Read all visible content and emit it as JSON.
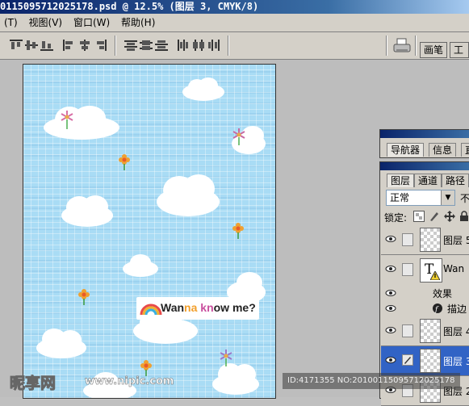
{
  "window": {
    "title": "0115095712025178.psd @ 12.5% (图层 3, CMYK/8)"
  },
  "menu": [
    {
      "label": "(T)"
    },
    {
      "label": "视图(V)"
    },
    {
      "label": "窗口(W)"
    },
    {
      "label": "帮助(H)"
    }
  ],
  "options_bar": {
    "palette_well_tabs": [
      {
        "label": "画笔"
      },
      {
        "label": "工具"
      }
    ]
  },
  "document": {
    "text_layer_content": {
      "part1": "Wan",
      "part2": "na ",
      "part3": "kn",
      "part4": "ow me?"
    }
  },
  "navigator_panel": {
    "tabs": [
      {
        "label": "导航器"
      },
      {
        "label": "信息"
      },
      {
        "label": "直"
      }
    ]
  },
  "layers_panel": {
    "tabs": [
      {
        "label": "图层"
      },
      {
        "label": "通道"
      },
      {
        "label": "路径"
      }
    ],
    "blend_mode": "正常",
    "opacity_label": "不",
    "lock_label": "锁定:",
    "layers": [
      {
        "name": "图层 5"
      },
      {
        "name": "Wan"
      },
      {
        "name": "效果"
      },
      {
        "name": "描边"
      },
      {
        "name": "图层 4"
      },
      {
        "name": "图层 3"
      },
      {
        "name": "图层 2"
      }
    ]
  },
  "watermark": {
    "logo": "昵享网",
    "url": "www.nipic.com",
    "id_text": "ID:4171355 NO:20100115095712025178"
  },
  "colors": {
    "title_blue": "#0a246a",
    "sky": "#a9dcf5",
    "selected_layer": "#3163c5"
  }
}
